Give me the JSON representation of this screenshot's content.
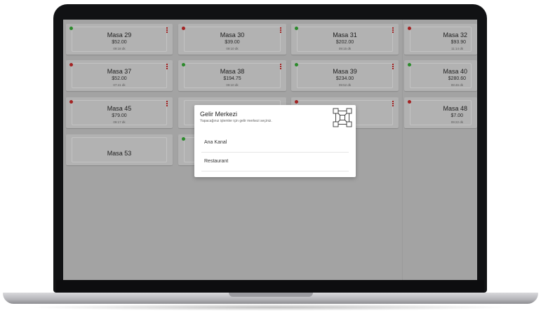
{
  "tables": [
    {
      "name": "Masa 29",
      "amount": "$52.00",
      "time": "09:18 dk",
      "status": "green",
      "menu": true
    },
    {
      "name": "Masa 30",
      "amount": "$39.00",
      "time": "09:10 dk",
      "status": "red",
      "menu": true
    },
    {
      "name": "Masa 31",
      "amount": "$202.00",
      "time": "09:15 dk",
      "status": "green",
      "menu": true
    },
    {
      "name": "Masa 32",
      "amount": "$93.90",
      "time": "11:14 dk",
      "status": "red",
      "menu": true
    },
    {
      "name": "Masa 37",
      "amount": "$52.00",
      "time": "07:41 dk",
      "status": "red",
      "menu": true
    },
    {
      "name": "Masa 38",
      "amount": "$194.75",
      "time": "09:10 dk",
      "status": "green",
      "menu": true
    },
    {
      "name": "Masa 39",
      "amount": "$234.00",
      "time": "09:52 dk",
      "status": "green",
      "menu": true
    },
    {
      "name": "Masa 40",
      "amount": "$280.60",
      "time": "08:46 dk",
      "status": "green",
      "menu": true
    },
    {
      "name": "Masa 45",
      "amount": "$79.00",
      "time": "09:17 dk",
      "status": "red",
      "menu": true
    },
    {
      "name": "",
      "amount": "",
      "time": "",
      "status": "",
      "menu": false
    },
    {
      "name": "",
      "amount": "",
      "time": "",
      "status": "red",
      "menu": true
    },
    {
      "name": "Masa 48",
      "amount": "$7.00",
      "time": "09:22 dk",
      "status": "red",
      "menu": true
    },
    {
      "name": "Masa 53",
      "amount": "",
      "time": "",
      "status": "",
      "menu": false
    },
    {
      "name": "",
      "amount": "",
      "time": "",
      "status": "green",
      "menu": false
    }
  ],
  "modal": {
    "title": "Gelir Merkezi",
    "subtitle": "Yapacağınız işlemler için gelir merkezi seçiniz.",
    "icon": "network-cubes-icon",
    "options": [
      "Ana Kanal",
      "Restaurant"
    ]
  },
  "colors": {
    "status_red": "#a32222",
    "status_green": "#2b8a2b",
    "overlay_gray": "#a3a3a3"
  }
}
